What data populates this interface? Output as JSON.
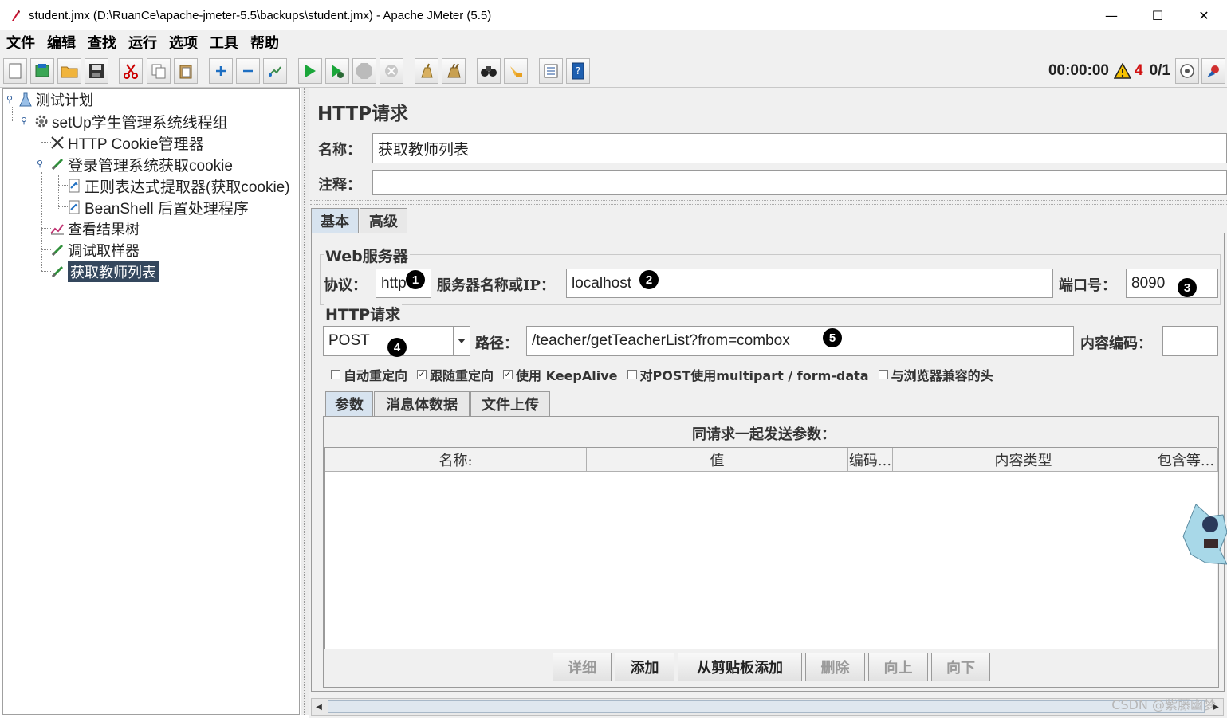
{
  "window": {
    "title": "student.jmx (D:\\RuanCe\\apache-jmeter-5.5\\backups\\student.jmx) - Apache JMeter (5.5)",
    "minimize": "—",
    "maximize": "☐",
    "close": "✕"
  },
  "menu": [
    "文件",
    "编辑",
    "查找",
    "运行",
    "选项",
    "工具",
    "帮助"
  ],
  "status": {
    "timer": "00:00:00",
    "warnings": "4",
    "threads": "0/1"
  },
  "tree": {
    "items": [
      {
        "label": "测试计划",
        "icon": "test-plan-icon"
      },
      {
        "label": "setUp学生管理系统线程组",
        "icon": "gear-icon"
      },
      {
        "label": "HTTP Cookie管理器",
        "icon": "wrench-icon"
      },
      {
        "label": "登录管理系统获取cookie",
        "icon": "pipette-icon"
      },
      {
        "label": "正则表达式提取器(获取cookie)",
        "icon": "post-processor-icon"
      },
      {
        "label": "BeanShell 后置处理程序",
        "icon": "post-processor-icon"
      },
      {
        "label": "查看结果树",
        "icon": "graph-icon"
      },
      {
        "label": "调试取样器",
        "icon": "pipette-icon"
      },
      {
        "label": "获取教师列表",
        "icon": "pipette-icon"
      }
    ]
  },
  "editor": {
    "heading": "HTTP请求",
    "name_label": "名称：",
    "name_value": "获取教师列表",
    "comment_label": "注释：",
    "comment_value": "",
    "tabs": [
      "基本",
      "高级"
    ],
    "web_server": {
      "title": "Web服务器",
      "protocol_label": "协议：",
      "protocol_value": "http",
      "server_label": "服务器名称或IP：",
      "server_value": "localhost",
      "port_label": "端口号：",
      "port_value": "8090"
    },
    "http_request": {
      "title": "HTTP请求",
      "method": "POST",
      "path_label": "路径：",
      "path_value": "/teacher/getTeacherList?from=combox",
      "encoding_label": "内容编码：",
      "encoding_value": ""
    },
    "checkboxes": [
      {
        "label": "自动重定向",
        "checked": false
      },
      {
        "label": "跟随重定向",
        "checked": true
      },
      {
        "label": "使用 KeepAlive",
        "checked": true
      },
      {
        "label": "对POST使用multipart / form-data",
        "checked": false
      },
      {
        "label": "与浏览器兼容的头",
        "checked": false
      }
    ],
    "sub_tabs": [
      "参数",
      "消息体数据",
      "文件上传"
    ],
    "params": {
      "caption": "同请求一起发送参数：",
      "columns": [
        "名称:",
        "值",
        "编码...",
        "内容类型",
        "包含等..."
      ],
      "rows": []
    },
    "buttons": [
      {
        "label": "详细",
        "enabled": false
      },
      {
        "label": "添加",
        "enabled": true
      },
      {
        "label": "从剪贴板添加",
        "enabled": true
      },
      {
        "label": "删除",
        "enabled": false
      },
      {
        "label": "向上",
        "enabled": false
      },
      {
        "label": "向下",
        "enabled": false
      }
    ],
    "annotations": [
      "1",
      "2",
      "3",
      "4",
      "5"
    ]
  },
  "watermark": "CSDN @紫藤幽梦",
  "colors": {
    "selection": "#34475d",
    "warning": "#d01010",
    "active_tab": "#d7e3ef"
  }
}
